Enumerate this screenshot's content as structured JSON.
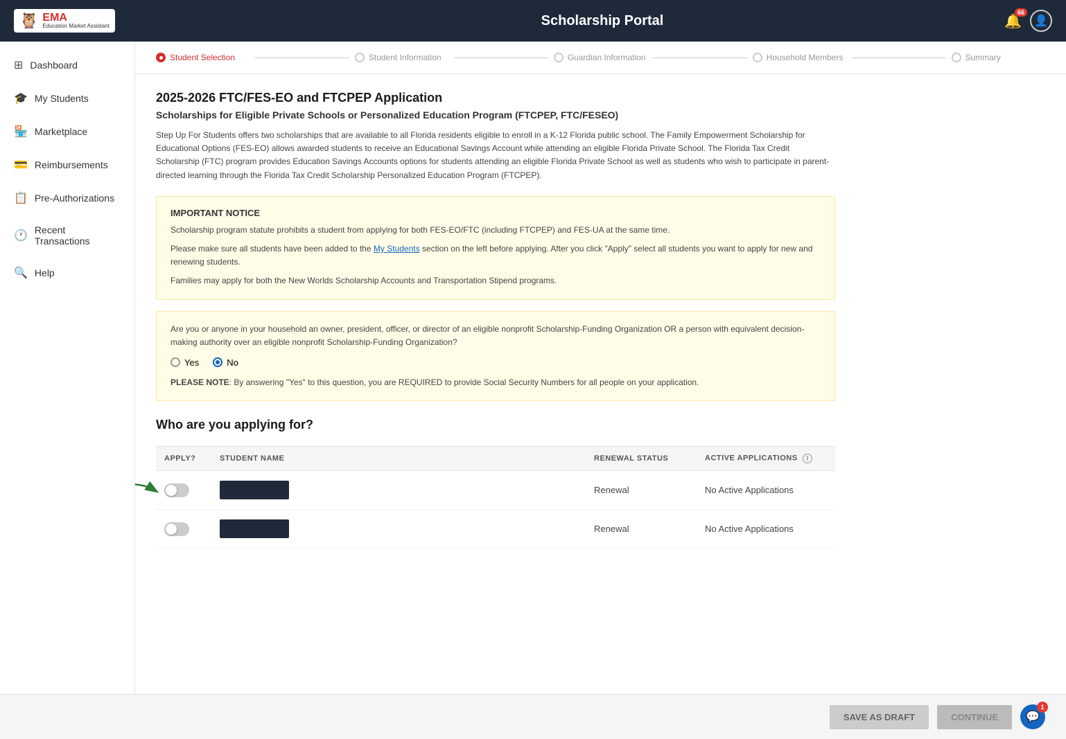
{
  "header": {
    "title": "Scholarship Portal",
    "notification_count": "66",
    "help_count": "1"
  },
  "logo": {
    "ema": "EMA",
    "subtitle": "Education Market Assistant",
    "owl": "🦉"
  },
  "sidebar": {
    "items": [
      {
        "id": "dashboard",
        "label": "Dashboard",
        "icon": "⊞"
      },
      {
        "id": "my-students",
        "label": "My Students",
        "icon": "🎓"
      },
      {
        "id": "marketplace",
        "label": "Marketplace",
        "icon": ""
      },
      {
        "id": "reimbursements",
        "label": "Reimbursements",
        "icon": ""
      },
      {
        "id": "pre-authorizations",
        "label": "Pre-Authorizations",
        "icon": ""
      },
      {
        "id": "recent-transactions",
        "label": "Recent Transactions",
        "icon": "🕐"
      },
      {
        "id": "help",
        "label": "Help",
        "icon": "🔍"
      }
    ]
  },
  "stepper": {
    "steps": [
      {
        "id": "student-selection",
        "label": "Student Selection",
        "active": true
      },
      {
        "id": "student-information",
        "label": "Student Information",
        "active": false
      },
      {
        "id": "guardian-information",
        "label": "Guardian Information",
        "active": false
      },
      {
        "id": "household-members",
        "label": "Household Members",
        "active": false
      },
      {
        "id": "summary",
        "label": "Summary",
        "active": false
      }
    ]
  },
  "page": {
    "title": "2025-2026 FTC/FES-EO and FTCPEP Application",
    "subtitle": "Scholarships for Eligible Private Schools or Personalized Education Program (FTCPEP, FTC/FESEO)",
    "description": "Step Up For Students offers two scholarships that are available to all Florida residents eligible to enroll in a K-12 Florida public school. The Family Empowerment Scholarship for Educational Options (FES-EO) allows awarded students to receive an Educational Savings Account while attending an eligible Florida Private School. The Florida Tax Credit Scholarship (FTC) program provides Education Savings Accounts options for students attending an eligible Florida Private School as well as students who wish to participate in parent-directed learning through the Florida Tax Credit Scholarship Personalized Education Program (FTCPEP).",
    "important_notice": {
      "title": "IMPORTANT NOTICE",
      "lines": [
        "Scholarship program statute prohibits a student from applying for both FES-EO/FTC (including FTCPEP) and FES-UA at the same time.",
        "Please make sure all students have been added to the My Students section on the left before applying. After you click \"Apply\" select all students you want to apply for new and renewing students.",
        "Families may apply for both the New Worlds Scholarship Accounts and Transportation Stipend programs."
      ]
    },
    "question": {
      "text": "Are you or anyone in your household an owner, president, officer, or director of an eligible nonprofit Scholarship-Funding Organization OR a person with equivalent decision-making authority over an eligible nonprofit Scholarship-Funding Organization?",
      "options": [
        "Yes",
        "No"
      ],
      "selected": "No",
      "note_label": "PLEASE NOTE",
      "note_text": ": By answering \"Yes\" to this question, you are REQUIRED to provide Social Security Numbers for all people on your application."
    },
    "applying_section": {
      "title": "Who are you applying for?",
      "table": {
        "columns": [
          "APPLY?",
          "STUDENT NAME",
          "RENEWAL STATUS",
          "ACTIVE APPLICATIONS"
        ],
        "rows": [
          {
            "apply": false,
            "name": "",
            "renewal": "Renewal",
            "active_apps": "No Active Applications"
          },
          {
            "apply": false,
            "name": "",
            "renewal": "Renewal",
            "active_apps": "No Active Applications"
          }
        ]
      }
    }
  },
  "footer": {
    "save_draft_label": "SAVE AS DRAFT",
    "continue_label": "CONTINUE"
  }
}
